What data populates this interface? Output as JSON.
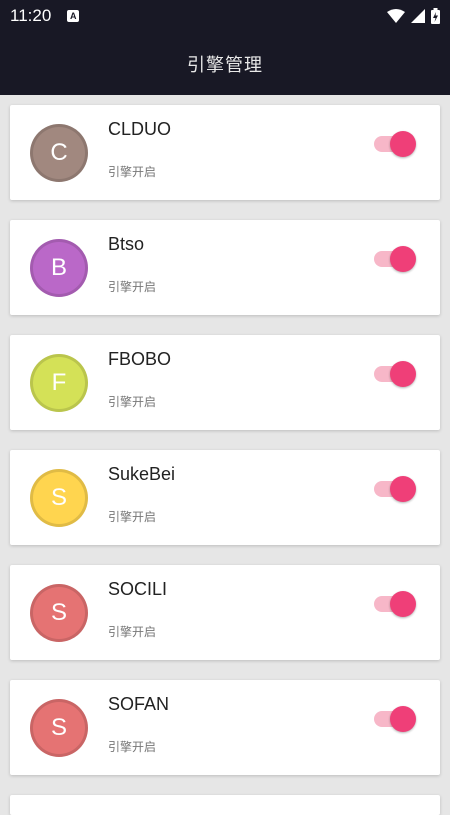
{
  "status_bar": {
    "time": "11:20",
    "notification_icon": "A"
  },
  "app_bar": {
    "title": "引擎管理"
  },
  "engines": [
    {
      "letter": "C",
      "name": "CLDUO",
      "status": "引擎开启",
      "color": "#a1887f",
      "enabled": true
    },
    {
      "letter": "B",
      "name": "Btso",
      "status": "引擎开启",
      "color": "#ba68c8",
      "enabled": true
    },
    {
      "letter": "F",
      "name": "FBOBO",
      "status": "引擎开启",
      "color": "#d4e157",
      "enabled": true
    },
    {
      "letter": "S",
      "name": "SukeBei",
      "status": "引擎开启",
      "color": "#ffd54f",
      "enabled": true
    },
    {
      "letter": "S",
      "name": "SOCILI",
      "status": "引擎开启",
      "color": "#e57373",
      "enabled": true
    },
    {
      "letter": "S",
      "name": "SOFAN",
      "status": "引擎开启",
      "color": "#e57373",
      "enabled": true
    }
  ],
  "colors": {
    "toolbar": "#181825",
    "switch_on": "#ef3f78",
    "switch_track": "#f7b7c8"
  }
}
